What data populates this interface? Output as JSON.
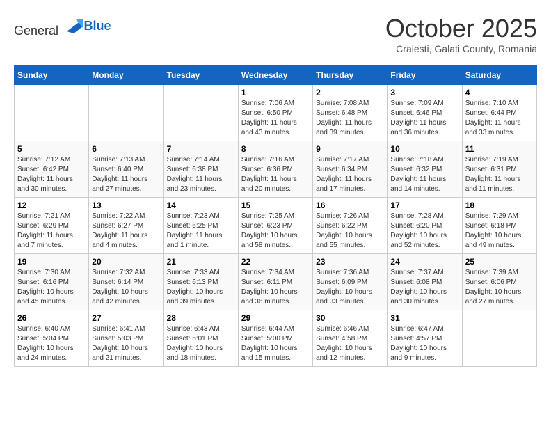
{
  "header": {
    "logo_general": "General",
    "logo_blue": "Blue",
    "month_title": "October 2025",
    "subtitle": "Craiesti, Galati County, Romania"
  },
  "weekdays": [
    "Sunday",
    "Monday",
    "Tuesday",
    "Wednesday",
    "Thursday",
    "Friday",
    "Saturday"
  ],
  "weeks": [
    [
      {
        "day": "",
        "info": ""
      },
      {
        "day": "",
        "info": ""
      },
      {
        "day": "",
        "info": ""
      },
      {
        "day": "1",
        "info": "Sunrise: 7:06 AM\nSunset: 6:50 PM\nDaylight: 11 hours and 43 minutes."
      },
      {
        "day": "2",
        "info": "Sunrise: 7:08 AM\nSunset: 6:48 PM\nDaylight: 11 hours and 39 minutes."
      },
      {
        "day": "3",
        "info": "Sunrise: 7:09 AM\nSunset: 6:46 PM\nDaylight: 11 hours and 36 minutes."
      },
      {
        "day": "4",
        "info": "Sunrise: 7:10 AM\nSunset: 6:44 PM\nDaylight: 11 hours and 33 minutes."
      }
    ],
    [
      {
        "day": "5",
        "info": "Sunrise: 7:12 AM\nSunset: 6:42 PM\nDaylight: 11 hours and 30 minutes."
      },
      {
        "day": "6",
        "info": "Sunrise: 7:13 AM\nSunset: 6:40 PM\nDaylight: 11 hours and 27 minutes."
      },
      {
        "day": "7",
        "info": "Sunrise: 7:14 AM\nSunset: 6:38 PM\nDaylight: 11 hours and 23 minutes."
      },
      {
        "day": "8",
        "info": "Sunrise: 7:16 AM\nSunset: 6:36 PM\nDaylight: 11 hours and 20 minutes."
      },
      {
        "day": "9",
        "info": "Sunrise: 7:17 AM\nSunset: 6:34 PM\nDaylight: 11 hours and 17 minutes."
      },
      {
        "day": "10",
        "info": "Sunrise: 7:18 AM\nSunset: 6:32 PM\nDaylight: 11 hours and 14 minutes."
      },
      {
        "day": "11",
        "info": "Sunrise: 7:19 AM\nSunset: 6:31 PM\nDaylight: 11 hours and 11 minutes."
      }
    ],
    [
      {
        "day": "12",
        "info": "Sunrise: 7:21 AM\nSunset: 6:29 PM\nDaylight: 11 hours and 7 minutes."
      },
      {
        "day": "13",
        "info": "Sunrise: 7:22 AM\nSunset: 6:27 PM\nDaylight: 11 hours and 4 minutes."
      },
      {
        "day": "14",
        "info": "Sunrise: 7:23 AM\nSunset: 6:25 PM\nDaylight: 11 hours and 1 minute."
      },
      {
        "day": "15",
        "info": "Sunrise: 7:25 AM\nSunset: 6:23 PM\nDaylight: 10 hours and 58 minutes."
      },
      {
        "day": "16",
        "info": "Sunrise: 7:26 AM\nSunset: 6:22 PM\nDaylight: 10 hours and 55 minutes."
      },
      {
        "day": "17",
        "info": "Sunrise: 7:28 AM\nSunset: 6:20 PM\nDaylight: 10 hours and 52 minutes."
      },
      {
        "day": "18",
        "info": "Sunrise: 7:29 AM\nSunset: 6:18 PM\nDaylight: 10 hours and 49 minutes."
      }
    ],
    [
      {
        "day": "19",
        "info": "Sunrise: 7:30 AM\nSunset: 6:16 PM\nDaylight: 10 hours and 45 minutes."
      },
      {
        "day": "20",
        "info": "Sunrise: 7:32 AM\nSunset: 6:14 PM\nDaylight: 10 hours and 42 minutes."
      },
      {
        "day": "21",
        "info": "Sunrise: 7:33 AM\nSunset: 6:13 PM\nDaylight: 10 hours and 39 minutes."
      },
      {
        "day": "22",
        "info": "Sunrise: 7:34 AM\nSunset: 6:11 PM\nDaylight: 10 hours and 36 minutes."
      },
      {
        "day": "23",
        "info": "Sunrise: 7:36 AM\nSunset: 6:09 PM\nDaylight: 10 hours and 33 minutes."
      },
      {
        "day": "24",
        "info": "Sunrise: 7:37 AM\nSunset: 6:08 PM\nDaylight: 10 hours and 30 minutes."
      },
      {
        "day": "25",
        "info": "Sunrise: 7:39 AM\nSunset: 6:06 PM\nDaylight: 10 hours and 27 minutes."
      }
    ],
    [
      {
        "day": "26",
        "info": "Sunrise: 6:40 AM\nSunset: 5:04 PM\nDaylight: 10 hours and 24 minutes."
      },
      {
        "day": "27",
        "info": "Sunrise: 6:41 AM\nSunset: 5:03 PM\nDaylight: 10 hours and 21 minutes."
      },
      {
        "day": "28",
        "info": "Sunrise: 6:43 AM\nSunset: 5:01 PM\nDaylight: 10 hours and 18 minutes."
      },
      {
        "day": "29",
        "info": "Sunrise: 6:44 AM\nSunset: 5:00 PM\nDaylight: 10 hours and 15 minutes."
      },
      {
        "day": "30",
        "info": "Sunrise: 6:46 AM\nSunset: 4:58 PM\nDaylight: 10 hours and 12 minutes."
      },
      {
        "day": "31",
        "info": "Sunrise: 6:47 AM\nSunset: 4:57 PM\nDaylight: 10 hours and 9 minutes."
      },
      {
        "day": "",
        "info": ""
      }
    ]
  ]
}
